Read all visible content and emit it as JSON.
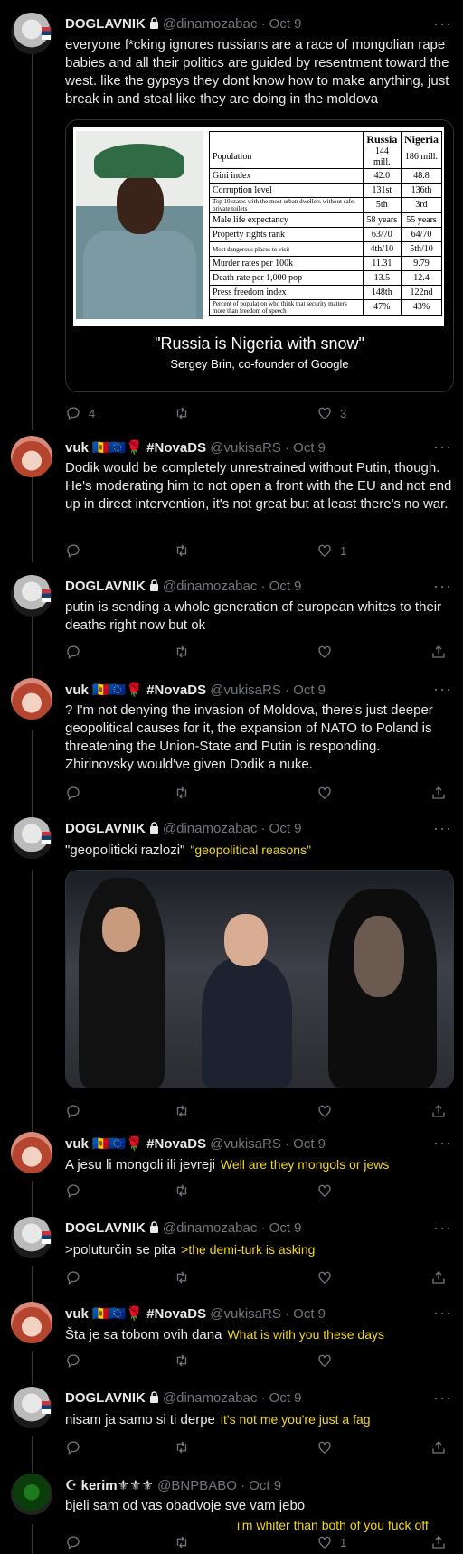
{
  "icons": {
    "reply": "reply-icon",
    "retweet": "retweet-icon",
    "like": "heart-icon",
    "share": "share-icon",
    "more": "more-dots-icon",
    "lock": "lock-icon"
  },
  "colors": {
    "translation": "#f1d61e",
    "muted": "#71767b",
    "background": "#000000"
  },
  "tweets": [
    {
      "name": "DOGLAVNIK",
      "handle": "@dinamozabac · Oct 9",
      "text": "everyone f*cking ignores russians are a race of mongolian rape babies and all their politics are guided by resentment toward the west. like the gypsys they dont know how to make anything, just break in and steal like they are doing in the moldova",
      "stats": {
        "replies": "4",
        "retweets": "",
        "likes": "3"
      }
    },
    {
      "name": "vuk 🇲🇩🇪🇺🌹 #NovaDS",
      "handle": "@vukisaRS · Oct 9",
      "text": "Dodik would be completely unrestrained without Putin, though. He's moderating him to not open a front with the EU and not end up in direct intervention, it's not great but at least there's no war.",
      "stats": {
        "replies": "",
        "retweets": "",
        "likes": "1"
      }
    },
    {
      "name": "DOGLAVNIK",
      "handle": "@dinamozabac · Oct 9",
      "text": "putin is sending a whole generation of european whites to their deaths right now but ok"
    },
    {
      "name": "vuk 🇲🇩🇪🇺🌹 #NovaDS",
      "handle": "@vukisaRS · Oct 9",
      "text": "? I'm not denying the invasion of Moldova, there's just deeper geopolitical causes for it, the expansion of NATO to Poland is threatening the Union-State and Putin is responding. Zhirinovsky would've given Dodik a nuke."
    },
    {
      "name": "DOGLAVNIK",
      "handle": "@dinamozabac · Oct 9",
      "text": "\"geopoliticki razlozi\"",
      "translation": "\"geopolitical reasons\""
    },
    {
      "name": "vuk 🇲🇩🇪🇺🌹 #NovaDS",
      "handle": "@vukisaRS · Oct 9",
      "text": "A jesu li mongoli ili jevreji",
      "translation": "Well are they mongols or jews"
    },
    {
      "name": "DOGLAVNIK",
      "handle": "@dinamozabac · Oct 9",
      "text": ">poluturčin se pita",
      "translation": ">the demi-turk is asking"
    },
    {
      "name": "vuk 🇲🇩🇪🇺🌹 #NovaDS",
      "handle": "@vukisaRS · Oct 9",
      "text": "Šta je sa tobom ovih dana",
      "translation": "What is with you these days"
    },
    {
      "name": "DOGLAVNIK",
      "handle": "@dinamozabac · Oct 9",
      "text": "nisam ja samo si ti derpe",
      "translation": "it's not me you're just a fag"
    },
    {
      "name": "☪ kerim⚜⚜⚜",
      "handle": "@BNPBABO · Oct 9",
      "text": "bjeli sam od vas obadvoje sve vam jebo",
      "translation": "i'm whiter than both of you fuck off",
      "stats": {
        "likes": "1"
      }
    }
  ],
  "meme": {
    "headers": [
      "",
      "Russia",
      "Nigeria"
    ],
    "rows": [
      [
        "Population",
        "144 mill.",
        "186 mill."
      ],
      [
        "Gini index",
        "42.0",
        "48.8"
      ],
      [
        "Corruption level",
        "131st",
        "136th"
      ],
      [
        "Top 10 states with the most urban dwellers without safe, private toilets",
        "5th",
        "3rd"
      ],
      [
        "Male life expectancy",
        "58 years",
        "55 years"
      ],
      [
        "Property rights rank",
        "63/70",
        "64/70"
      ],
      [
        "Most dangerous places to visit",
        "4th/10",
        "5th/10"
      ],
      [
        "Murder rates per 100k",
        "11.31",
        "9.79"
      ],
      [
        "Death rate per 1,000 pop",
        "13.5",
        "12.4"
      ],
      [
        "Press freedom index",
        "148th",
        "122nd"
      ],
      [
        "Percent of population who think that security matters more than freedom of speech",
        "47%",
        "43%"
      ]
    ],
    "quote": "\"Russia is Nigeria with snow\"",
    "attribution": "Sergey Brin, co-founder of Google"
  }
}
